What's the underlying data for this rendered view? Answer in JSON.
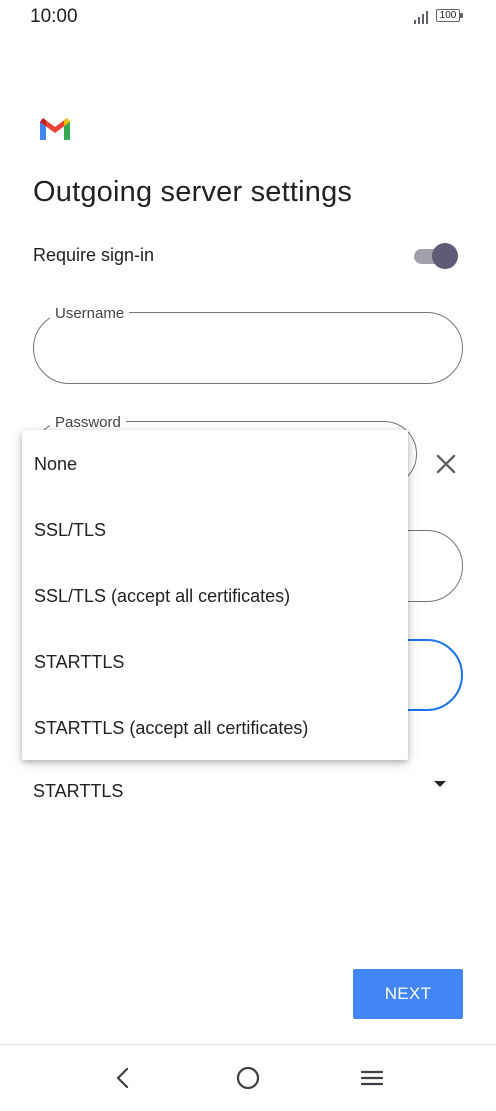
{
  "status_bar": {
    "time": "10:00",
    "battery": "100"
  },
  "header": {
    "title": "Outgoing server settings"
  },
  "require_signin": {
    "label": "Require sign-in",
    "enabled": true
  },
  "username": {
    "label": "Username",
    "value": ""
  },
  "password": {
    "label": "Password",
    "value": ""
  },
  "security": {
    "selected": "STARTTLS"
  },
  "dropdown": {
    "options": [
      "None",
      "SSL/TLS",
      "SSL/TLS (accept all certificates)",
      "STARTTLS",
      "STARTTLS (accept all certificates)"
    ]
  },
  "buttons": {
    "next": "NEXT"
  },
  "nav": {
    "back_icon": "back-icon",
    "home_icon": "home-icon",
    "menu_icon": "menu-icon"
  },
  "colors": {
    "accent": "#4285f4",
    "focus": "#1a73e8",
    "toggle_knob": "#5f5a75"
  }
}
